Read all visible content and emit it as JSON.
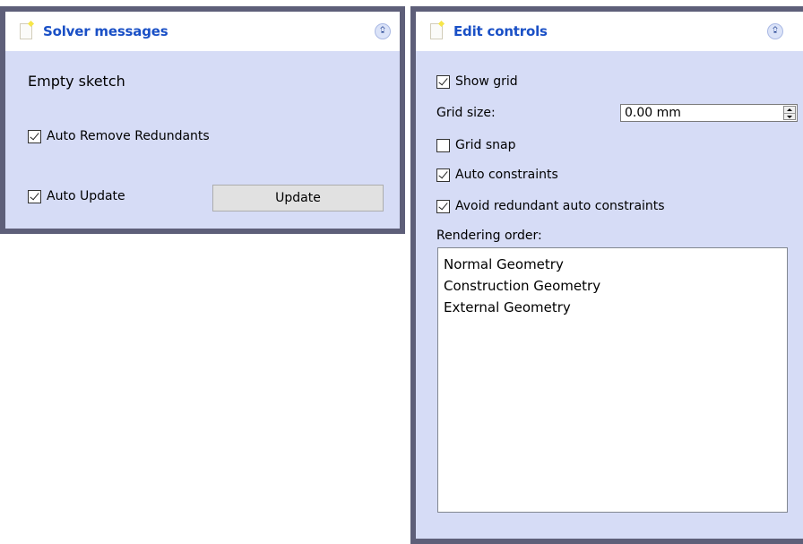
{
  "solver_messages": {
    "title": "Solver messages",
    "collapse_icon": "double-chevron-up-icon",
    "status_text": "Empty sketch",
    "auto_remove_redundants": {
      "label": "Auto Remove Redundants",
      "checked": true
    },
    "auto_update": {
      "label": "Auto Update",
      "checked": true
    },
    "update_button": "Update"
  },
  "edit_controls": {
    "title": "Edit controls",
    "collapse_icon": "double-chevron-up-icon",
    "show_grid": {
      "label": "Show grid",
      "checked": true
    },
    "grid_size_label": "Grid size:",
    "grid_size_value": "0.00 mm",
    "grid_snap": {
      "label": "Grid snap",
      "checked": false
    },
    "auto_constraints": {
      "label": "Auto constraints",
      "checked": true
    },
    "avoid_redundant": {
      "label": "Avoid redundant auto constraints",
      "checked": true
    },
    "rendering_order_label": "Rendering order:",
    "rendering_order": [
      "Normal Geometry",
      "Construction Geometry",
      "External Geometry"
    ]
  },
  "colors": {
    "panel_background": "#d6dcf6",
    "panel_border": "#5e5f79",
    "title_text": "#1a50c6"
  }
}
